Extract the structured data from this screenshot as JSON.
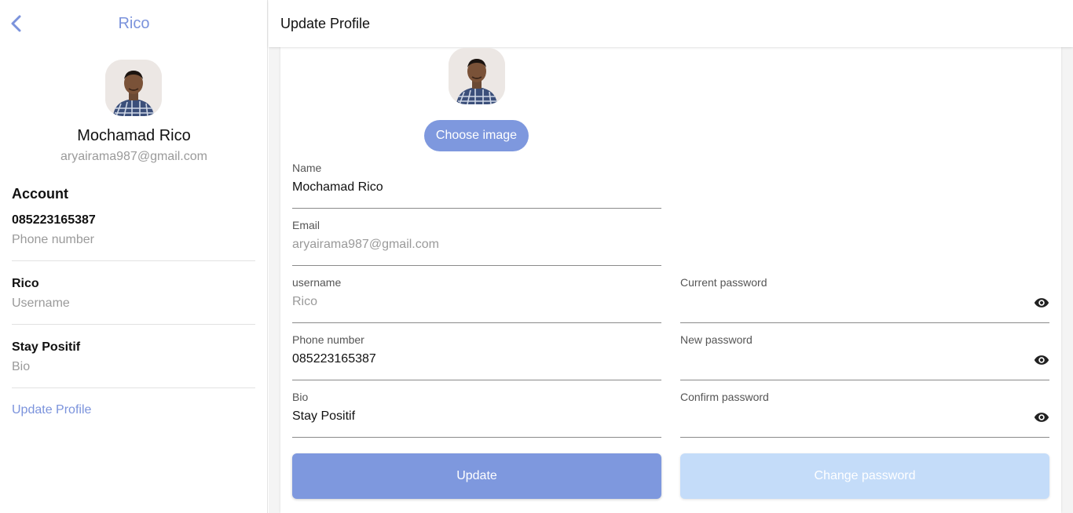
{
  "sidebar": {
    "title": "Rico",
    "name": "Mochamad Rico",
    "email": "aryairama987@gmail.com",
    "account_heading": "Account",
    "items": [
      {
        "value": "085223165387",
        "label": "Phone number"
      },
      {
        "value": "Rico",
        "label": "Username"
      },
      {
        "value": "Stay Positif",
        "label": "Bio"
      }
    ],
    "update_link": "Update Profile"
  },
  "header": {
    "title": "Update Profile"
  },
  "form": {
    "choose_image": "Choose image",
    "name": {
      "label": "Name",
      "value": "Mochamad Rico"
    },
    "email": {
      "label": "Email",
      "value": "aryairama987@gmail.com"
    },
    "username": {
      "label": "username",
      "value": "Rico"
    },
    "phone": {
      "label": "Phone number",
      "value": "085223165387"
    },
    "bio": {
      "label": "Bio",
      "value": "Stay Positif"
    },
    "current_password": {
      "label": "Current password",
      "value": ""
    },
    "new_password": {
      "label": "New password",
      "value": ""
    },
    "confirm_password": {
      "label": "Confirm password",
      "value": ""
    },
    "update_button": "Update",
    "change_password_button": "Change password"
  },
  "colors": {
    "accent": "#7e98de",
    "accent_light": "#c4dcf9",
    "link": "#7b93dc",
    "muted_text": "#9a9a9a"
  },
  "icons": {
    "back": "chevron-left-icon",
    "eye": "eye-icon"
  }
}
